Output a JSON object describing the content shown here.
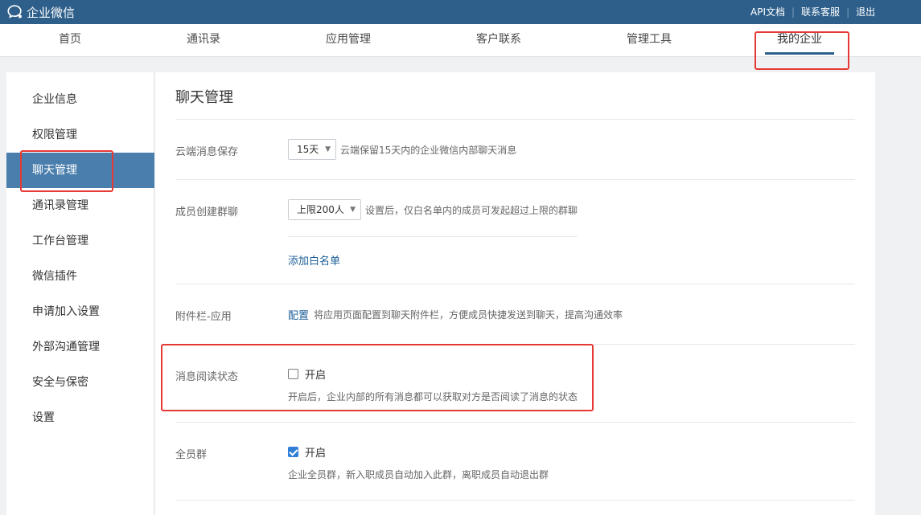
{
  "app": {
    "title": "企业微信"
  },
  "top_links": [
    "API文档",
    "联系客服",
    "退出"
  ],
  "nav": [
    "首页",
    "通讯录",
    "应用管理",
    "客户联系",
    "管理工具",
    "我的企业"
  ],
  "sidebar": [
    "企业信息",
    "权限管理",
    "聊天管理",
    "通讯录管理",
    "工作台管理",
    "微信插件",
    "申请加入设置",
    "外部沟通管理",
    "安全与保密",
    "设置"
  ],
  "content": {
    "title": "聊天管理",
    "cloud": {
      "label": "云端消息保存",
      "value": "15天",
      "hint": "云端保留15天内的企业微信内部聊天消息"
    },
    "group": {
      "label": "成员创建群聊",
      "value": "上限200人",
      "hint": "设置后，仅白名单内的成员可发起超过上限的群聊",
      "whitelist": "添加白名单"
    },
    "attach": {
      "label": "附件栏-应用",
      "config": "配置",
      "hint": "将应用页面配置到聊天附件栏，方便成员快捷发送到聊天，提高沟通效率"
    },
    "read": {
      "label": "消息阅读状态",
      "option": "开启",
      "checked": false,
      "hint": "开启后，企业内部的所有消息都可以获取对方是否阅读了消息的状态"
    },
    "all": {
      "label": "全员群",
      "option": "开启",
      "checked": true,
      "hint": "企业全员群，新入职成员自动加入此群，离职成员自动退出群"
    }
  },
  "colors": {
    "topbar": "#2d5f8a",
    "active_sidebar": "#4a7ead",
    "link": "#1d5f99",
    "annotation": "#e53935"
  }
}
